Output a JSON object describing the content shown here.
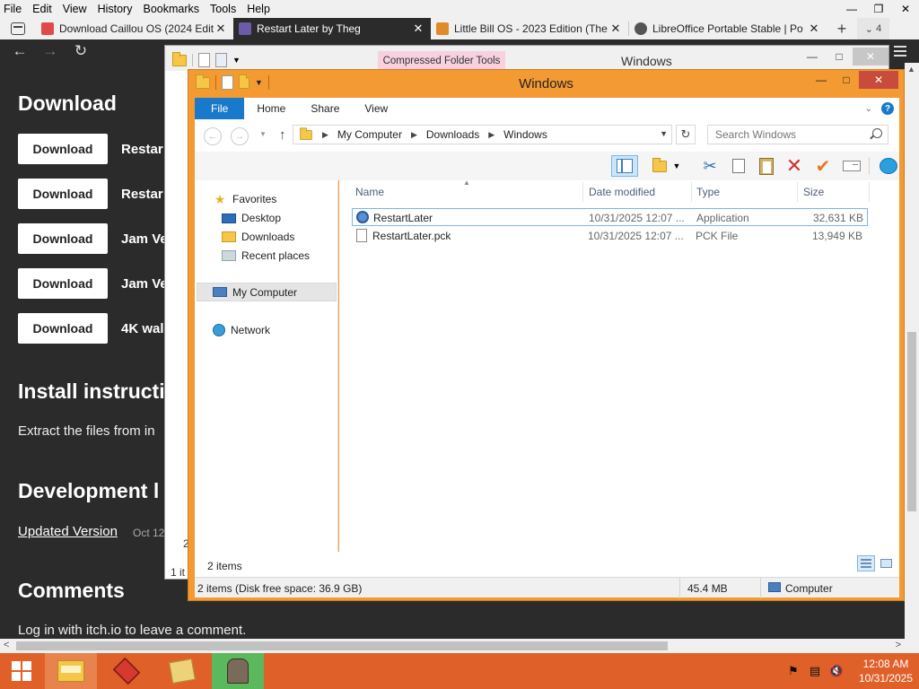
{
  "browser": {
    "menu": [
      "File",
      "Edit",
      "View",
      "History",
      "Bookmarks",
      "Tools",
      "Help"
    ],
    "tabs": [
      {
        "title": "Download Caillou OS (2024 Edit",
        "favicon_color": "#e04a4a",
        "active": false
      },
      {
        "title": "Restart Later by Theg",
        "favicon_color": "#6b5ba8",
        "active": true
      },
      {
        "title": "Little Bill OS - 2023 Edition (The",
        "favicon_color": "#e08a2a",
        "active": false
      },
      {
        "title": "LibreOffice Portable Stable | Po",
        "favicon_color": "#555555",
        "active": false
      }
    ],
    "tab_count": "4",
    "tab_plus": "+"
  },
  "page": {
    "download_heading": "Download",
    "downloads": [
      {
        "button": "Download",
        "name": "Restar"
      },
      {
        "button": "Download",
        "name": "Restar"
      },
      {
        "button": "Download",
        "name": "Jam Ve"
      },
      {
        "button": "Download",
        "name": "Jam Ve"
      },
      {
        "button": "Download",
        "name": "4K wal"
      }
    ],
    "install_heading": "Install instructi",
    "install_text": "Extract the files from in",
    "dev_heading": "Development l",
    "dev_link": "Updated Version",
    "dev_date": "Oct 12",
    "comments_heading": "Comments",
    "comments_text": "Log in with itch.io to leave a comment."
  },
  "bg_window": {
    "context_tab": "Compressed Folder Tools",
    "title": "Windows",
    "stub_a": "2",
    "stub_b": "1 it"
  },
  "explorer": {
    "title": "Windows",
    "ribbon_tabs": [
      "File",
      "Home",
      "Share",
      "View"
    ],
    "address": [
      "My Computer",
      "Downloads",
      "Windows"
    ],
    "search_placeholder": "Search Windows",
    "nav": {
      "favorites": "Favorites",
      "desktop": "Desktop",
      "downloads": "Downloads",
      "recent": "Recent places",
      "computer": "My Computer",
      "network": "Network"
    },
    "columns": [
      "Name",
      "Date modified",
      "Type",
      "Size"
    ],
    "files": [
      {
        "name": "RestartLater",
        "date": "10/31/2025 12:07 ...",
        "type": "Application",
        "size": "32,631 KB"
      },
      {
        "name": "RestartLater.pck",
        "date": "10/31/2025 12:07 ...",
        "type": "PCK File",
        "size": "13,949 KB"
      }
    ],
    "item_count": "2 items",
    "status_left": "2 items (Disk free space: 36.9 GB)",
    "status_size": "45.4 MB",
    "status_location": "Computer"
  },
  "taskbar": {
    "time": "12:08 AM",
    "date": "10/31/2025"
  },
  "colors": {
    "explorer_frame": "#f49a32",
    "taskbar": "#e0602a",
    "accent_blue": "#1979ca",
    "close_red": "#c74c3c"
  }
}
